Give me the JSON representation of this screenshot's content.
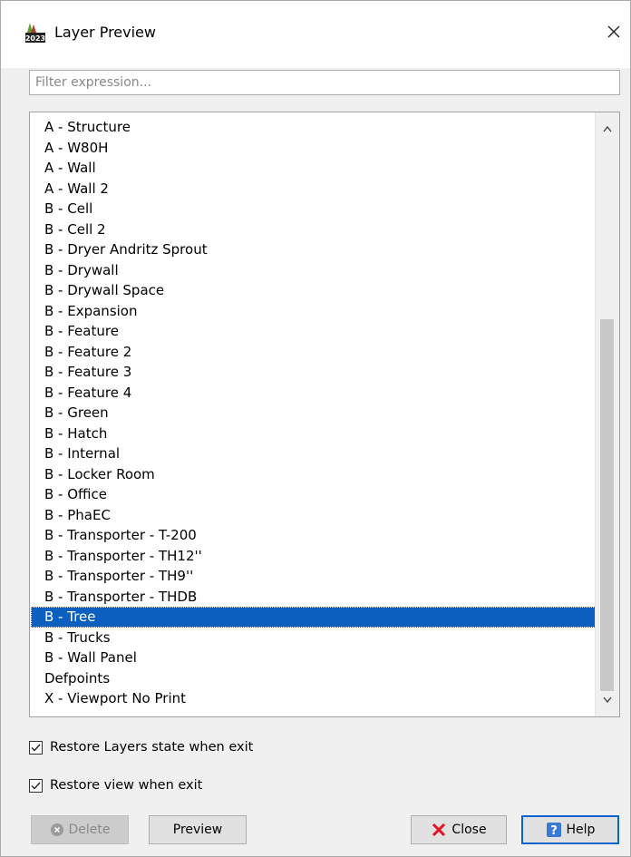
{
  "window": {
    "title": "Layer Preview",
    "app_icon": "autocad-2023-icon",
    "app_icon_text": "2023"
  },
  "filter": {
    "placeholder": "Filter expression...",
    "value": ""
  },
  "layers": [
    "A - Structure",
    "A - W80H",
    "A - Wall",
    "A - Wall 2",
    "B - Cell",
    "B - Cell 2",
    "B - Dryer Andritz Sprout",
    "B - Drywall",
    "B - Drywall Space",
    "B - Expansion",
    "B - Feature",
    "B - Feature 2",
    "B - Feature 3",
    "B - Feature 4",
    "B - Green",
    "B - Hatch",
    "B - Internal",
    "B - Locker Room",
    "B - Office",
    "B - PhaEC",
    "B - Transporter - T-200",
    "B - Transporter - TH12''",
    "B - Transporter - TH9''",
    "B - Transporter - THDB",
    "B - Tree",
    "B - Trucks",
    "B - Wall Panel",
    "Defpoints",
    "X - Viewport No Print"
  ],
  "selected_layer": "B - Tree",
  "options": {
    "restore_layers": {
      "label": "Restore Layers state when exit",
      "checked": true
    },
    "restore_view": {
      "label": "Restore view when exit",
      "checked": true
    }
  },
  "buttons": {
    "delete": {
      "label": "Delete",
      "enabled": false,
      "icon": "cancel-circle-icon"
    },
    "preview": {
      "label": "Preview"
    },
    "close": {
      "label": "Close",
      "icon": "red-x-icon",
      "icon_color": "#e81123"
    },
    "help": {
      "label": "Help",
      "icon": "help-question-icon",
      "icon_color": "#3a7ad5"
    }
  },
  "colors": {
    "selection": "#0a5fbf",
    "accent": "#0a64d0"
  }
}
